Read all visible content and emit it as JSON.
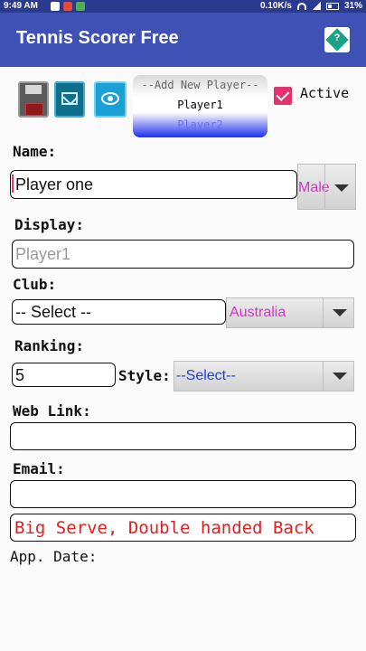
{
  "status_bar": {
    "time": "9:49 AM",
    "speed": "0.10K/s",
    "battery": "31%"
  },
  "app_bar": {
    "title": "Tennis Scorer Free",
    "help_icon_label": "?"
  },
  "toolbar": {
    "icons": [
      "save-icon",
      "mail-icon",
      "view-icon"
    ]
  },
  "player_list": {
    "items": [
      "--Add New Player--",
      "Player1",
      "Player2"
    ]
  },
  "active": {
    "label": "Active",
    "checked": true
  },
  "form": {
    "name_label": "Name:",
    "name_value": "Player one",
    "gender_value": "Male",
    "display_label": "Display:",
    "display_placeholder": "Player1",
    "club_label": "Club:",
    "club_value": "-- Select --",
    "country_value": "Australia",
    "ranking_label": "Ranking:",
    "ranking_value": "5",
    "style_label": "Style:",
    "style_value": "--Select--",
    "weblink_label": "Web Link:",
    "weblink_value": "",
    "email_label": "Email:",
    "email_value": "",
    "notes_value": "Big Serve, Double handed Back",
    "app_date_label": "App. Date:"
  },
  "colors": {
    "app_bar": "#3f51b5",
    "status_bar": "#2a3a8e",
    "accent_pink": "#e3336e",
    "magenta_text": "#d633c9",
    "blue_text": "#1b3fe0",
    "notes_red": "#e02020"
  }
}
